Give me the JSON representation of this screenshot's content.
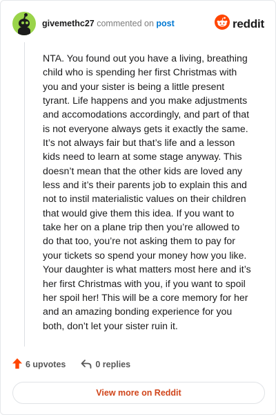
{
  "header": {
    "username": "givemethc27",
    "action_text": "commented on",
    "post_link": "post",
    "brand": "reddit"
  },
  "comment": {
    "text": "NTA. You found out you have a living, breathing child who is spending her first Christmas with you and your sister is being a little present tyrant. Life happens and you make adjustments and accomodations accordingly, and part of that is not everyone always gets it exactly the same. It’s not always fair but that’s life and a lesson kids need to learn at some stage anyway. This doesn’t mean that the other kids are loved any less and it’s their parents job to explain this and not to instil materialistic values on their children that would give them this idea. If you want to take her on a plane trip then you’re allowed to do that too, you’re not asking them to pay for your tickets so spend your money how you like. Your daughter is what matters most here and it’s her first Christmas with you, if you want to spoil her spoil her! This will be a core memory for her and an amazing bonding experience for you both, don’t let your sister ruin it."
  },
  "footer": {
    "upvotes": "6 upvotes",
    "replies": "0 replies"
  },
  "view_more": "View more on Reddit",
  "colors": {
    "reddit_orange": "#ff4500",
    "link_blue": "#0079d3",
    "avatar_green": "#9ad44a",
    "view_more_text": "#d0451b"
  },
  "icons": {
    "avatar": "snoo-avatar-icon",
    "brand": "reddit-logo-icon",
    "upvote": "upvote-arrow-icon",
    "reply": "reply-arrow-icon"
  }
}
